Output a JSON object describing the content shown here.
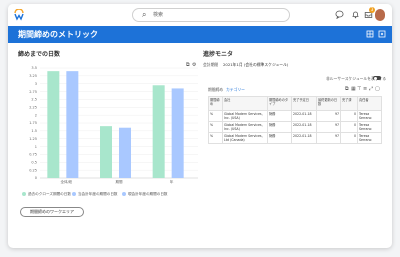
{
  "app": {
    "search_placeholder": "検索",
    "notification_count": "3"
  },
  "header": {
    "title": "期間締めのメトリック"
  },
  "left": {
    "section_title": "締めまでの日数",
    "workarea_button": "期間締めのワークエリア"
  },
  "chart_data": {
    "type": "bar",
    "categories": [
      "全体/総",
      "期間",
      "年"
    ],
    "series": [
      {
        "name": "過去のクローズ期間の日数",
        "color": "#a8e6cc",
        "values": [
          3.4,
          1.65,
          2.95
        ]
      },
      {
        "name": "当会計年度の期間の日数",
        "color": "#a9c8ff",
        "values": [
          3.4,
          1.6,
          2.85
        ]
      }
    ],
    "legend_extra": "現会計年度の期間の日数",
    "legend_extra_color": "#a9c8ff",
    "y_ticks": [
      "0",
      "0.25",
      "0.5",
      "0.75",
      "1",
      "1.25",
      "1.5",
      "1.75",
      "2",
      "2.25",
      "2.5",
      "2.75",
      "3",
      "3.25",
      "3.5"
    ],
    "ylim": [
      0,
      3.5
    ],
    "grid": true
  },
  "right": {
    "section_title": "進捗モニタ",
    "period_label": "会計期間",
    "period_value": "2021年1月 (会社の標準スケジュール)",
    "toggle_label": "非ルーサースケジュールを表示する",
    "filter_label": "期間締め",
    "filter_value": "カテゴリー",
    "table": {
      "headers": [
        "期間締め",
        "会社",
        "期間締めのタイプ",
        "完了予定日",
        "最終更新の日数",
        "完了済",
        "責任者"
      ],
      "rows": [
        {
          "pct": "%",
          "company": "Global Modern Services, Inc. (USA)",
          "type": "財務",
          "date": "2022-01-18",
          "days": "97",
          "done": "0",
          "owner": "Teresa Serrano"
        },
        {
          "pct": "%",
          "company": "Global Modern Services, Inc. (USA)",
          "type": "財務",
          "date": "2022-01-18",
          "days": "97",
          "done": "0",
          "owner": "Teresa Serrano"
        },
        {
          "pct": "%",
          "company": "Global Modern Services, Ltd (Canada)",
          "type": "財務",
          "date": "2022-01-18",
          "days": "97",
          "done": "0",
          "owner": "Teresa Serrano"
        }
      ]
    }
  }
}
